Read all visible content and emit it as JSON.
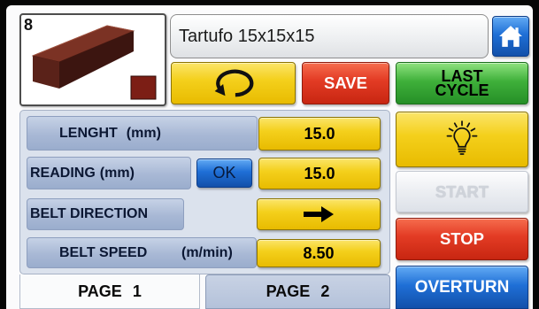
{
  "recipe": {
    "slot": "8",
    "name": "Tartufo 15x15x15",
    "product_icon": "bar-product-icon"
  },
  "header": {
    "home_icon": "home-icon"
  },
  "toolbar": {
    "rotate_icon": "rotate-icon",
    "save_label": "SAVE",
    "last_cycle_line1": "LAST",
    "last_cycle_line2": "CYCLE"
  },
  "params": {
    "length": {
      "label": "LENGHT",
      "unit": "(mm)",
      "value": "15.0"
    },
    "reading": {
      "label": "READING",
      "unit": "(mm)",
      "ok_label": "OK",
      "value": "15.0"
    },
    "belt_direction": {
      "label": "BELT DIRECTION",
      "icon": "arrow-right-icon"
    },
    "belt_speed": {
      "label": "BELT SPEED",
      "unit": "(m/min)",
      "value": "8.50"
    }
  },
  "controls": {
    "light_icon": "lightbulb-icon",
    "start_label": "START",
    "start_enabled": false,
    "stop_label": "STOP",
    "overturn_label": "OVERTURN"
  },
  "tabs": [
    {
      "label": "PAGE",
      "number": "1",
      "active": true
    },
    {
      "label": "PAGE",
      "number": "2",
      "active": false
    }
  ],
  "colors": {
    "yellow": "#f4d01c",
    "red": "#e33c25",
    "green": "#3fb03a",
    "blue": "#1f6fd6",
    "panel": "#dbe2ed",
    "label": "#a8b8d5",
    "tab": "#b4c2da"
  }
}
